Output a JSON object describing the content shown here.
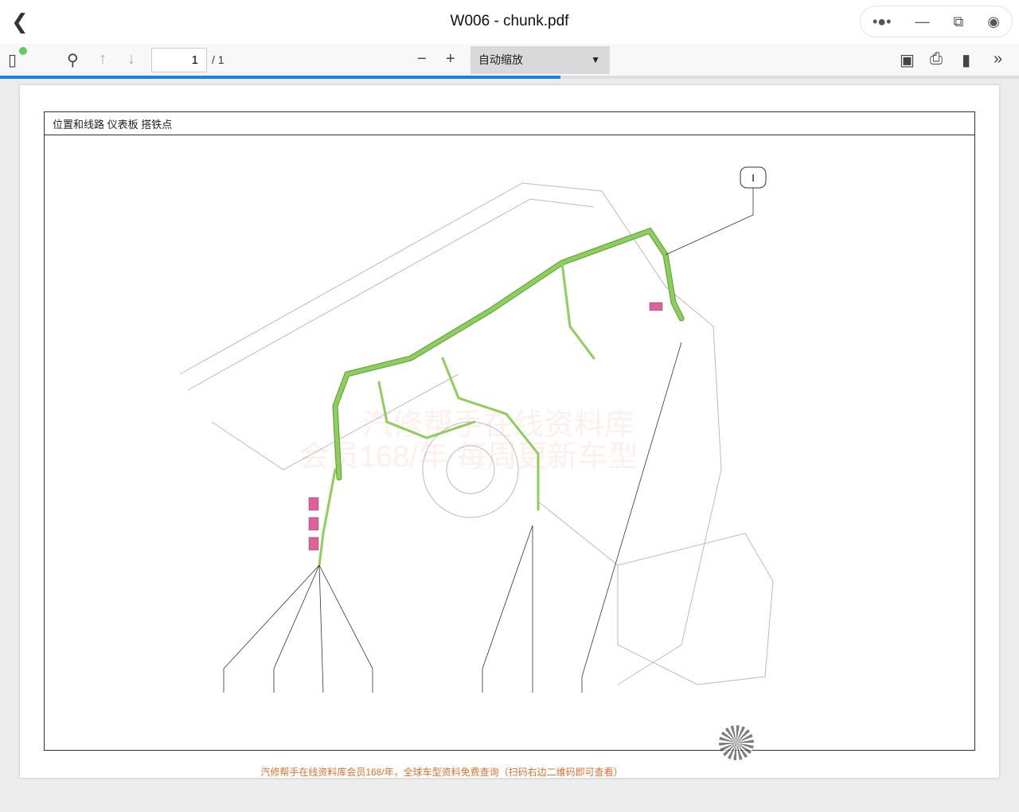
{
  "window": {
    "title": "W006 - chunk.pdf",
    "controls": [
      "more-icon",
      "minimize-icon",
      "restore-icon",
      "record-icon"
    ]
  },
  "toolbar": {
    "page_current": "1",
    "page_total": "/ 1",
    "zoom_select": "自动缩放",
    "load_progress_percent": 55
  },
  "document": {
    "header": "位置和线路  仪表板  搭铁点",
    "callout_label": "I",
    "footer": "汽修帮手在线资料库会员168/年，全球车型资料免费查询（扫码右边二维码即可查看）",
    "watermark_line1": "汽修帮手在线资料库",
    "watermark_line2": "会员168/年 每周更新车型",
    "harness_color": "#8ccf5a",
    "connector_color": "#e0609a"
  }
}
